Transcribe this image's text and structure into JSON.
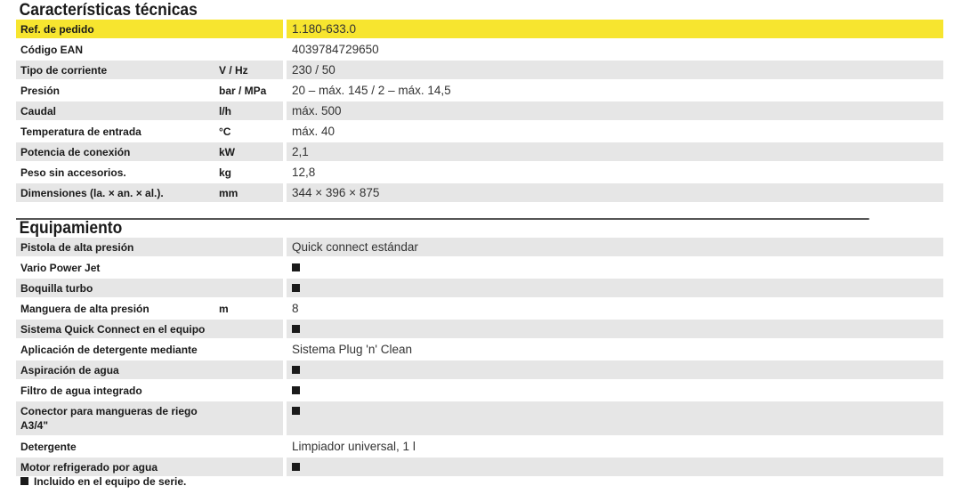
{
  "technical": {
    "title": "Características técnicas",
    "rows": [
      {
        "label": "Ref. de pedido",
        "unit": "",
        "value": "1.180-633.0"
      },
      {
        "label": "Código EAN",
        "unit": "",
        "value": "4039784729650"
      },
      {
        "label": "Tipo de corriente",
        "unit": "V / Hz",
        "value": "230 / 50"
      },
      {
        "label": "Presión",
        "unit": "bar / MPa",
        "value": "20 – máx. 145 / 2 – máx. 14,5"
      },
      {
        "label": "Caudal",
        "unit": "l/h",
        "value": "máx. 500"
      },
      {
        "label": "Temperatura de entrada",
        "unit": "°C",
        "value": "máx. 40"
      },
      {
        "label": "Potencia de conexión",
        "unit": "kW",
        "value": "2,1"
      },
      {
        "label": "Peso sin accesorios.",
        "unit": "kg",
        "value": "12,8"
      },
      {
        "label": "Dimensiones (la. × an. × al.).",
        "unit": "mm",
        "value": "344 × 396 × 875"
      }
    ]
  },
  "equipment": {
    "title": "Equipamiento",
    "rows": [
      {
        "label": "Pistola de alta presión",
        "unit": "",
        "value": "Quick connect estándar"
      },
      {
        "label": "Vario Power Jet",
        "unit": "",
        "value": ""
      },
      {
        "label": "Boquilla turbo",
        "unit": "",
        "value": ""
      },
      {
        "label": "Manguera de alta presión",
        "unit": "m",
        "value": "8"
      },
      {
        "label": "Sistema Quick Connect en el equipo",
        "unit": "",
        "value": ""
      },
      {
        "label": "Aplicación de detergente mediante",
        "unit": "",
        "value": "Sistema Plug 'n' Clean"
      },
      {
        "label": "Aspiración de agua",
        "unit": "",
        "value": ""
      },
      {
        "label": "Filtro de agua integrado",
        "unit": "",
        "value": ""
      },
      {
        "label": "Conector para mangueras de riego A3/4\"",
        "unit": "",
        "value": ""
      },
      {
        "label": "Detergente",
        "unit": "",
        "value": "Limpiador universal, 1 l"
      },
      {
        "label": "Motor refrigerado por agua",
        "unit": "",
        "value": ""
      }
    ]
  },
  "footnote": "Incluido en el equipo de serie.",
  "colors": {
    "highlight": "#f7e52f",
    "stripe": "#e6e6e6",
    "bullet": "#1a1a1a"
  },
  "icons": {
    "included": "filled-square-icon"
  }
}
